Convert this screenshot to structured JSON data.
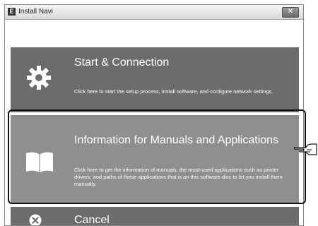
{
  "window": {
    "title": "Install Navi",
    "app_icon_glyph": "E",
    "close_glyph": "✕"
  },
  "menu": {
    "start": {
      "icon": "gear-icon",
      "title": "Start & Connection",
      "description": "Click here to start the setup process, install software, and configure network settings."
    },
    "info": {
      "icon": "book-icon",
      "title": "Information for Manuals and Applications",
      "description": "Click here to get the information of manuals, the most-used applications such as printer drivers, and paths of these applications that is on this software disc to let you install them manually.",
      "highlighted": true
    },
    "cancel": {
      "icon": "close-circle-icon",
      "title": "Cancel"
    }
  },
  "annotation": {
    "pointer": "pointing-hand-icon"
  },
  "colors": {
    "tile_dark": "#6c6c6c",
    "tile_selected": "#8f8f8f",
    "tile_text": "#ffffff",
    "highlight_border": "#111111"
  }
}
